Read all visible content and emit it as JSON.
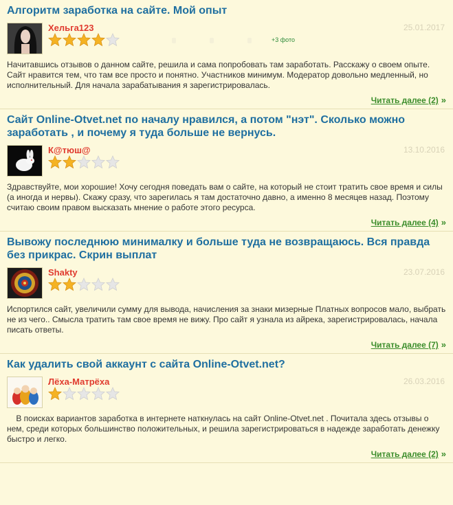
{
  "reviews": [
    {
      "title": "Алгоритм заработка на сайте. Мой опыт",
      "author": "Хельга123",
      "rating": 4,
      "date": "25.01.2017",
      "photos": "+3 фото",
      "avatar": "woman-portrait",
      "text": "Начитавшись отзывов о данном сайте, решила и сама попробовать там заработать. Расскажу о своем опыте. Сайт нравится тем, что там все просто и понятно. Участников минимум. Модератор довольно медленный, но исполнительный. Для начала зарабатывания я зарегистрировалась.",
      "read_more": "Читать далее (2)"
    },
    {
      "title": "Сайт Online-Otvet.net по началу нравился, а потом \"нэт\". Сколько можно заработать , и почему я туда больше не вернусь.",
      "author": "К@тюш@",
      "rating": 2,
      "date": "13.10.2016",
      "photos": "",
      "avatar": "white-rabbit",
      "text": "Здравствуйте, мои хорошие! Хочу сегодня поведать вам о сайте, на который не стоит тратить свое время и силы (а иногда и нервы). Скажу сразу, что зарегилась я там достаточно давно, а именно 8 месяцев назад. Поэтому считаю своим правом высказать мнение о работе этого ресурса.",
      "read_more": "Читать далее (4)"
    },
    {
      "title": "Вывожу последнюю минималку и больше туда не возвращаюсь. Вся правда без прикрас. Скрин выплат",
      "author": "Shakty",
      "rating": 2,
      "date": "23.07.2016",
      "photos": "",
      "avatar": "mandala",
      "text": "Испортился сайт, увеличили сумму для вывода, начисления за знаки мизерные Платных вопросов мало, выбрать не из чего.. Смысла тратить там свое время не вижу. Про сайт я узнала из айрека, зарегистрировалась, начала писать ответы.",
      "read_more": "Читать далее (7)"
    },
    {
      "title": "Как удалить свой аккаунт с сайта Online-Otvet.net?",
      "author": "Лёха-Матрёха",
      "rating": 1,
      "date": "26.03.2016",
      "photos": "",
      "avatar": "matryoshka",
      "text": "    В поисках вариантов заработка в интернете наткнулась на сайт Online-Otvet.net . Почитала здесь отзывы о нем, среди которых большинство положительных, и решила зарегистрироваться в надежде заработать денежку быстро и легко.",
      "read_more": "Читать далее (2)"
    }
  ],
  "colors": {
    "background": "#fdf9dc",
    "title": "#1f6fa0",
    "author": "#e03b2f",
    "link": "#3b8d2b",
    "star_filled": "#f5b323",
    "star_empty": "#e6e6e6"
  },
  "icons": {
    "star": "star-icon",
    "arrow": "double-chevron-right-icon"
  }
}
